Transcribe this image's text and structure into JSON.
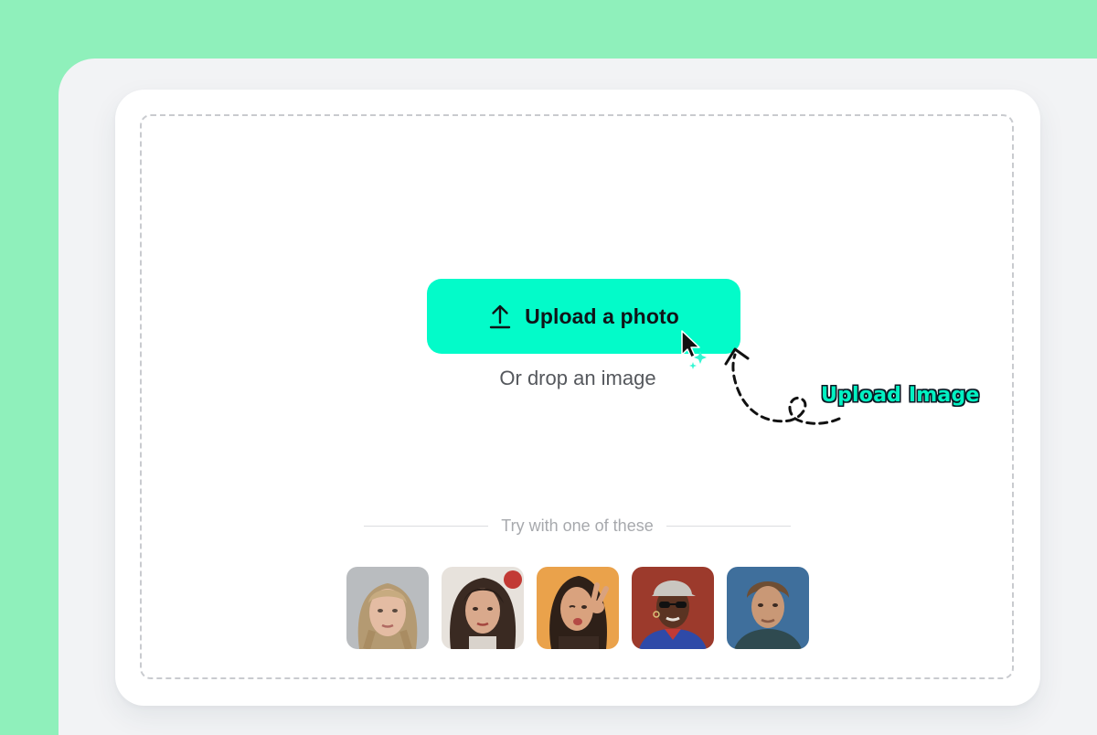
{
  "upload": {
    "button_label": "Upload a photo",
    "drop_hint": "Or drop an image",
    "button_icon": "upload-arrow-icon",
    "accent_color": "#03fbc9"
  },
  "annotation": {
    "label": "Upload Image"
  },
  "samples": {
    "heading": "Try with one of these",
    "items": [
      {
        "icon": "portrait-thumbnail-1"
      },
      {
        "icon": "portrait-thumbnail-2"
      },
      {
        "icon": "portrait-thumbnail-3"
      },
      {
        "icon": "portrait-thumbnail-4"
      },
      {
        "icon": "portrait-thumbnail-5"
      }
    ]
  },
  "colors": {
    "background_green": "#8ff0bb",
    "panel_gray": "#f2f3f5",
    "card_white": "#ffffff"
  }
}
